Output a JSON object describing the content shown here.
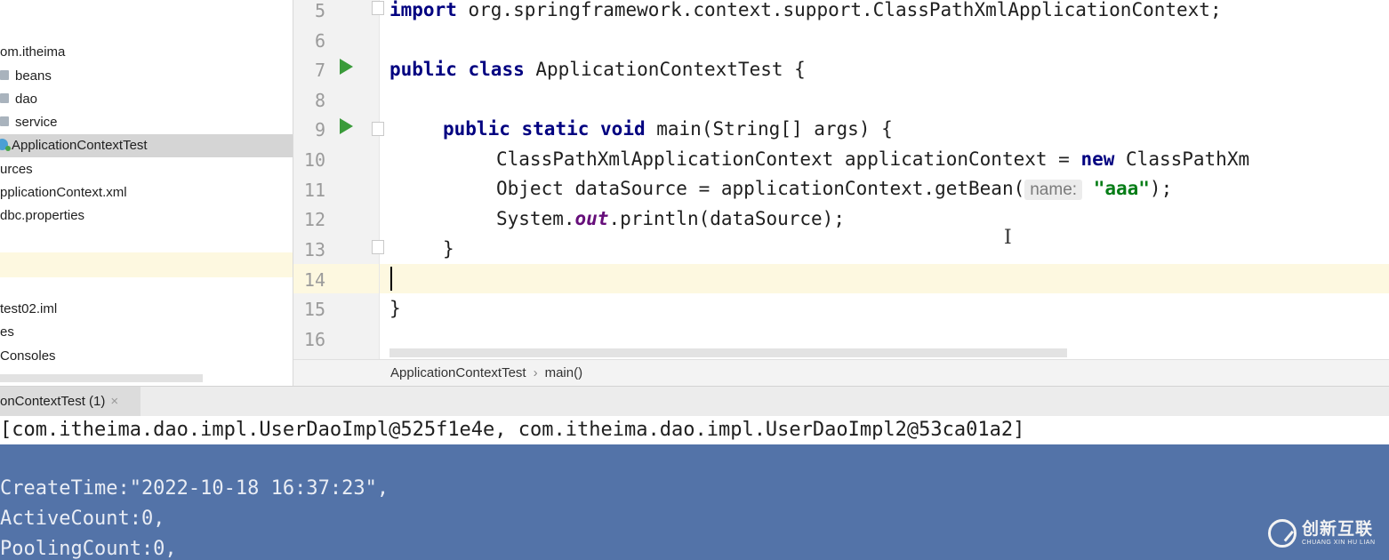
{
  "project_tree": {
    "items": [
      {
        "label": "om.itheima",
        "icon": "none",
        "selected": false
      },
      {
        "label": "beans",
        "icon": "folder-icon",
        "selected": false
      },
      {
        "label": "dao",
        "icon": "folder-icon",
        "selected": false
      },
      {
        "label": "service",
        "icon": "folder-icon",
        "selected": false
      },
      {
        "label": "ApplicationContextTest",
        "icon": "class-icon",
        "selected": true
      },
      {
        "label": "urces",
        "icon": "none",
        "selected": false
      },
      {
        "label": "pplicationContext.xml",
        "icon": "none",
        "selected": false
      },
      {
        "label": "dbc.properties",
        "icon": "none",
        "selected": false
      },
      {
        "label": "test02.iml",
        "icon": "none",
        "selected": false
      },
      {
        "label": "es",
        "icon": "none",
        "selected": false
      },
      {
        "label": "Consoles",
        "icon": "none",
        "selected": false
      }
    ]
  },
  "editor": {
    "line_numbers": [
      "5",
      "6",
      "7",
      "8",
      "9",
      "10",
      "11",
      "12",
      "13",
      "14",
      "15",
      "16"
    ],
    "code": {
      "l5_kw": "import",
      "l5_rest": " org.springframework.context.support.ClassPathXmlApplicationContext;",
      "l7_kw1": "public",
      "l7_kw2": "class",
      "l7_rest": " ApplicationContextTest {",
      "l9_kw1": "public",
      "l9_kw2": "static",
      "l9_kw3": "void",
      "l9_rest": " main(String[] args) {",
      "l10_a": "ClassPathXmlApplicationContext applicationContext = ",
      "l10_kw": "new",
      "l10_b": " ClassPathXm",
      "l11_a": "Object dataSource = applicationContext.getBean(",
      "l11_hint": "name:",
      "l11_str": "\"aaa\"",
      "l11_b": ");",
      "l12_a": "System.",
      "l12_fld": "out",
      "l12_b": ".println(dataSource);",
      "l13": "}",
      "l15": "}"
    },
    "ibeam": "I"
  },
  "breadcrumb": {
    "class_name": "ApplicationContextTest",
    "separator": "›",
    "method": "main()"
  },
  "run_panel": {
    "tab_label": "onContextTest (1)",
    "close_glyph": "×"
  },
  "console": {
    "lines": [
      "[com.itheima.dao.impl.UserDaoImpl@525f1e4e, com.itheima.dao.impl.UserDaoImpl2@53ca01a2]",
      "CreateTime:\"2022-10-18 16:37:23\",",
      "ActiveCount:0,",
      "PoolingCount:0,"
    ]
  },
  "watermark": {
    "cn": "创新互联",
    "en": "CHUANG XIN HU LIAN"
  },
  "colors": {
    "keyword": "#000080",
    "string": "#067d17",
    "selection": "#5373a8",
    "caret_line": "#fdf8e0",
    "run_icon": "#3a9b3a"
  }
}
